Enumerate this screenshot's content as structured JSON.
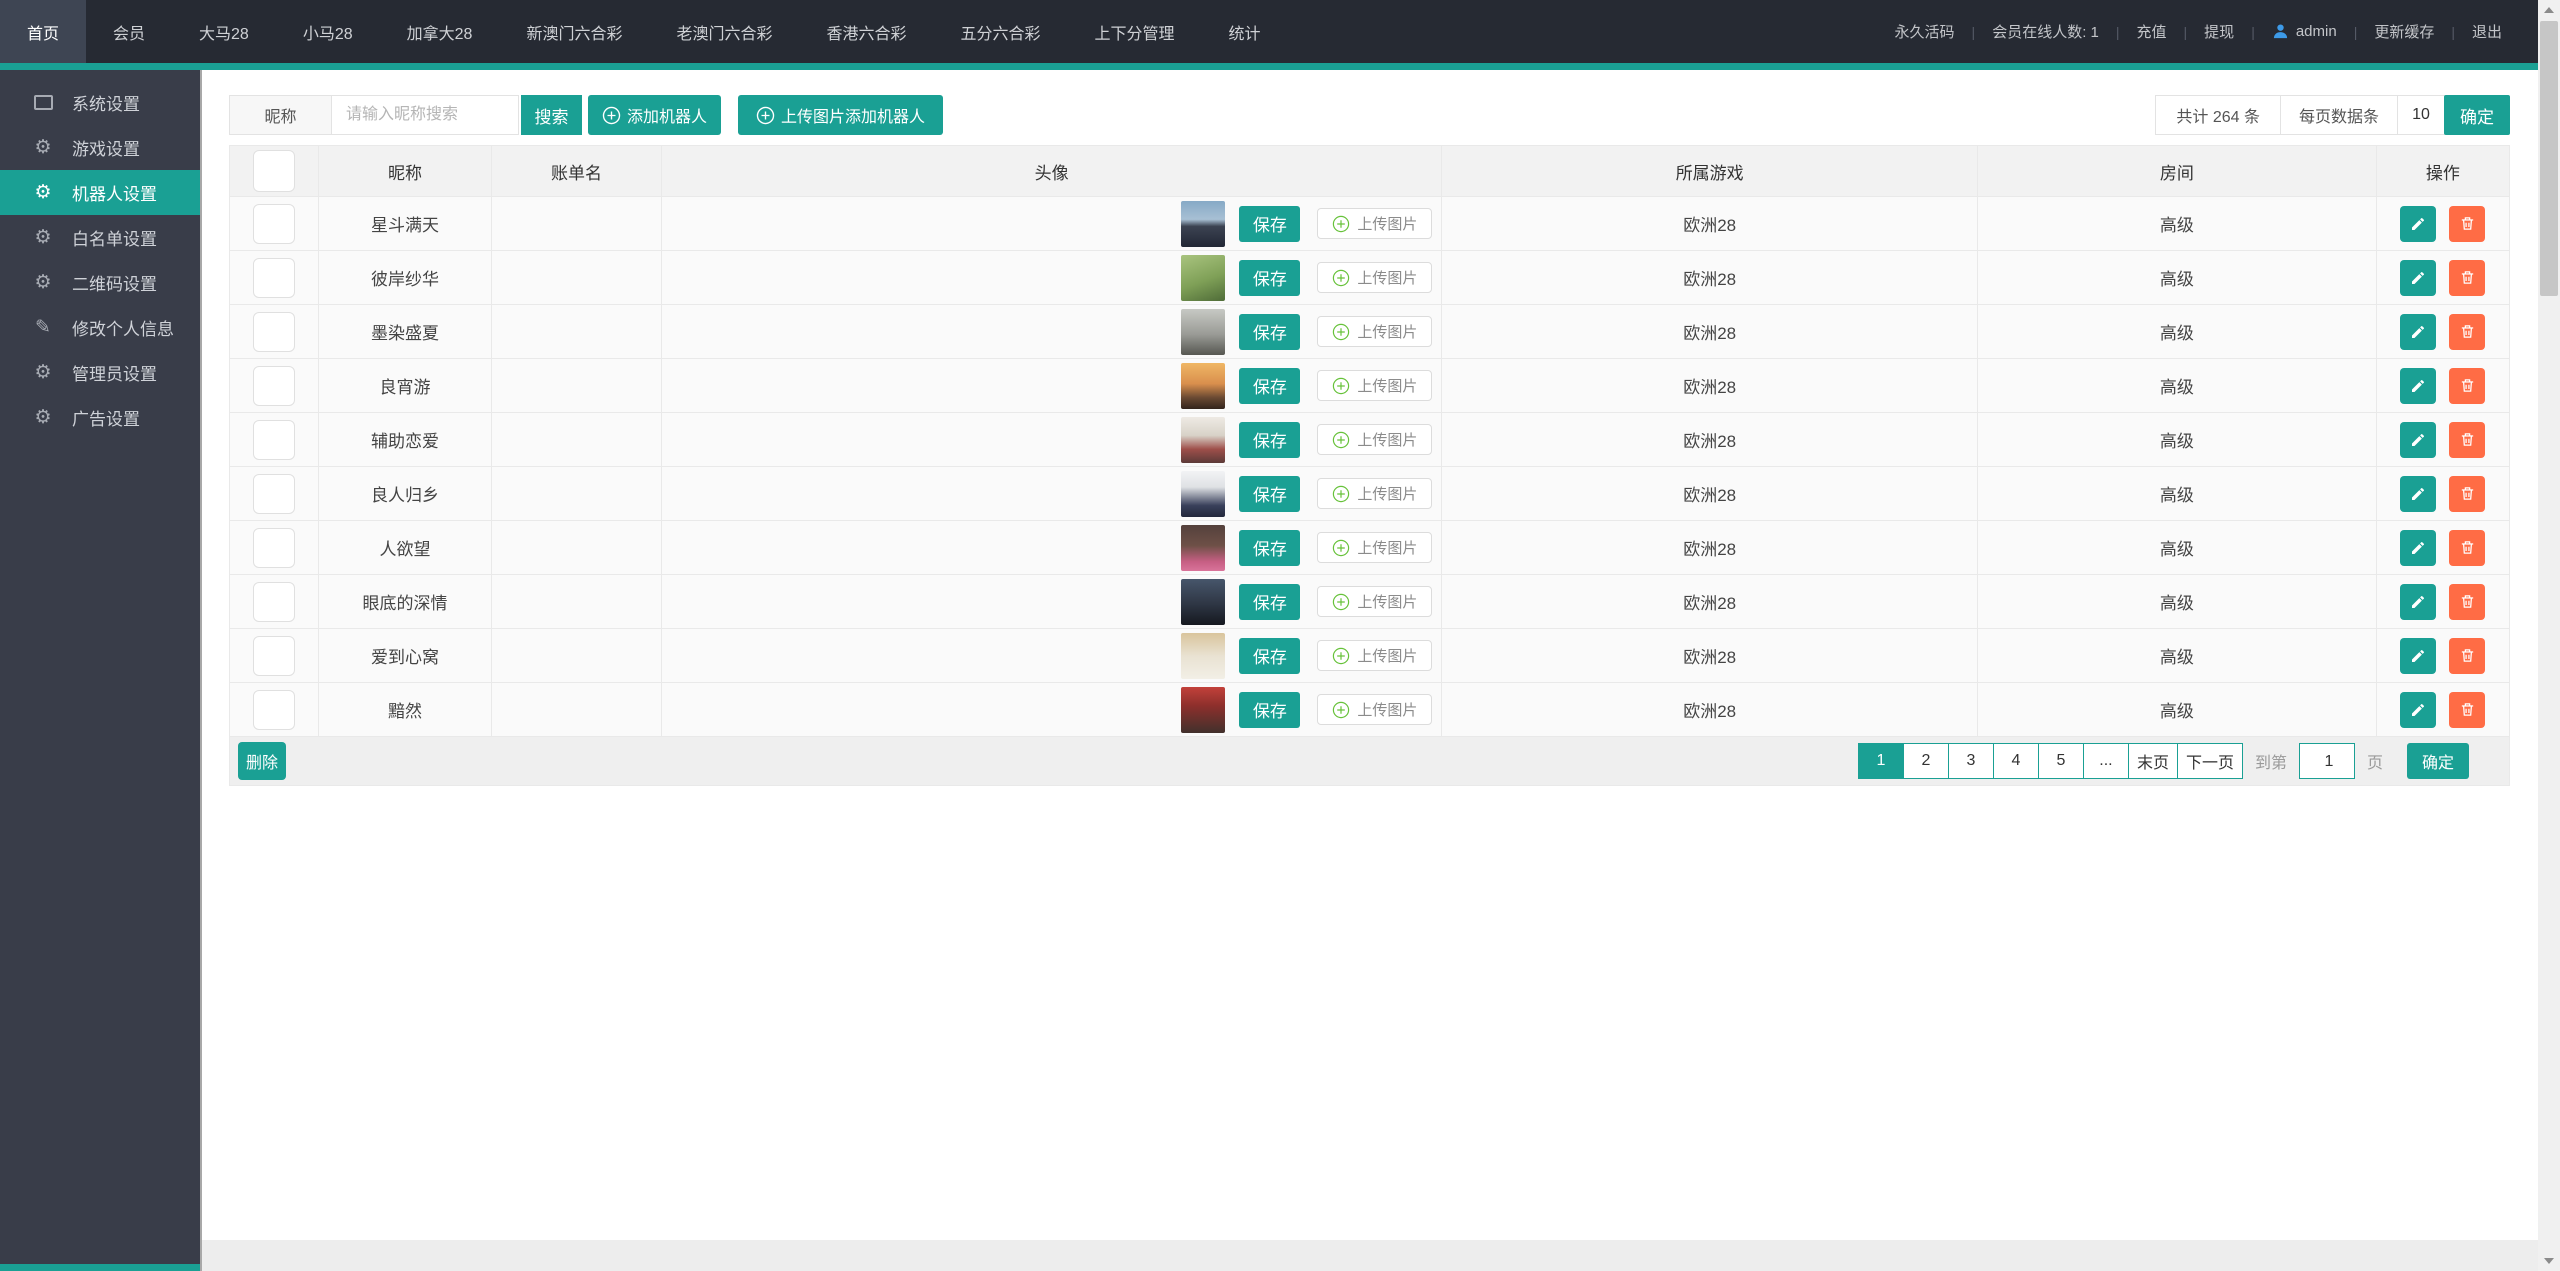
{
  "colors": {
    "accent": "#1aa094",
    "danger_orange": "#ff6c45",
    "topbar_bg": "#262a33",
    "sidebar_bg": "#393d49",
    "admin_icon_blue": "#3d9ae8"
  },
  "topbar": {
    "nav": [
      "首页",
      "会员",
      "大马28",
      "小马28",
      "加拿大28",
      "新澳门六合彩",
      "老澳门六合彩",
      "香港六合彩",
      "五分六合彩",
      "上下分管理",
      "统计"
    ],
    "active_tab": "首页",
    "right": {
      "live_code": "永久活码",
      "online": "会员在线人数: 1",
      "recharge": "充值",
      "withdraw": "提现",
      "username": "admin",
      "refresh_cache": "更新缓存",
      "logout": "退出"
    }
  },
  "sidebar": {
    "items": [
      "系统设置",
      "游戏设置",
      "机器人设置",
      "白名单设置",
      "二维码设置",
      "修改个人信息",
      "管理员设置",
      "广告设置"
    ],
    "active_item": "机器人设置"
  },
  "toolbar": {
    "filter_label": "昵称",
    "search_placeholder": "请输入昵称搜索",
    "search_button": "搜索",
    "add_robot_button": "添加机器人",
    "upload_add_button": "上传图片添加机器人",
    "total_text": "共计 264 条",
    "per_page_label": "每页数据条",
    "per_page_value": "10",
    "confirm_button": "确定"
  },
  "table": {
    "headers": [
      "昵称",
      "账单名",
      "头像",
      "所属游戏",
      "房间",
      "操作"
    ],
    "save_label": "保存",
    "upload_label": "上传图片",
    "rows": [
      {
        "name": "星斗满天",
        "account": "",
        "game": "欧洲28",
        "room": "高级",
        "avatar_bg": "background:linear-gradient(180deg,#86a9c6 0%,#a8c0d4 40%,#3c4352 55%,#222735 100%)"
      },
      {
        "name": "彼岸纱华",
        "account": "",
        "game": "欧洲28",
        "room": "高级",
        "avatar_bg": "background:linear-gradient(160deg,#a9c47f 0%,#7fa057 55%,#4f6c38 100%)"
      },
      {
        "name": "墨染盛夏",
        "account": "",
        "game": "欧洲28",
        "room": "高级",
        "avatar_bg": "background:linear-gradient(180deg,#c7c9c4 0%,#9a9b96 55%,#565751 100%)"
      },
      {
        "name": "良宵游",
        "account": "",
        "game": "欧洲28",
        "room": "高级",
        "avatar_bg": "background:linear-gradient(180deg,#f0b765 0%,#d98f4d 45%,#6b4a33 75%,#33241c 100%)"
      },
      {
        "name": "辅助恋爱",
        "account": "",
        "game": "欧洲28",
        "room": "高级",
        "avatar_bg": "background:linear-gradient(180deg,#eeeae4 0%,#d8d2c8 40%,#9e4f4a 70%,#5c3a38 100%)"
      },
      {
        "name": "良人归乡",
        "account": "",
        "game": "欧洲28",
        "room": "高级",
        "avatar_bg": "background:linear-gradient(180deg,#f2f3f5 0%,#dfe1e4 35%,#39405b 75%,#23283c 100%)"
      },
      {
        "name": "人欲望",
        "account": "",
        "game": "欧洲28",
        "room": "高级",
        "avatar_bg": "background:linear-gradient(180deg,#54413c 0%,#6e5047 45%,#c75f84 80%,#d9739a 100%)"
      },
      {
        "name": "眼底的深情",
        "account": "",
        "game": "欧洲28",
        "room": "高级",
        "avatar_bg": "background:linear-gradient(180deg,#47566b 0%,#2e3644 55%,#15181f 100%)"
      },
      {
        "name": "爱到心窝",
        "account": "",
        "game": "欧洲28",
        "room": "高级",
        "avatar_bg": "background:linear-gradient(180deg,#d9c49c 0%,#e9e2d2 50%,#f2efe6 100%)"
      },
      {
        "name": "黯然",
        "account": "",
        "game": "欧洲28",
        "room": "高级",
        "avatar_bg": "background:linear-gradient(180deg,#c2413a 0%,#8e2f2c 40%,#41302c 100%)"
      }
    ]
  },
  "footer": {
    "delete_button": "删除",
    "pages": [
      "1",
      "2",
      "3",
      "4",
      "5",
      "...",
      "末页",
      "下一页"
    ],
    "active_page": "1",
    "goto_label": "到第",
    "goto_value": "1",
    "page_unit": "页",
    "confirm_button": "确定"
  }
}
